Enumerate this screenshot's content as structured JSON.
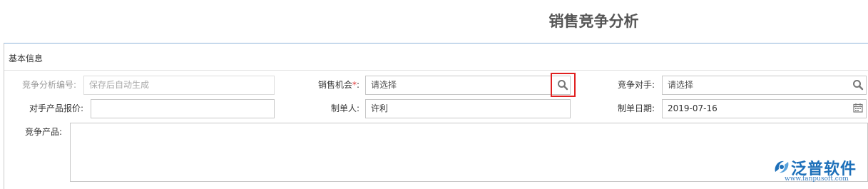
{
  "page": {
    "title": "销售竞争分析"
  },
  "section": {
    "title": "基本信息"
  },
  "fields": {
    "analysis_no": {
      "label": "竞争分析编号:",
      "placeholder": "保存后自动生成"
    },
    "sales_opportunity": {
      "label": "销售机会",
      "required_mark": "*",
      "colon": ":",
      "value": "请选择"
    },
    "competitor": {
      "label": "竞争对手:",
      "value": "请选择"
    },
    "competitor_price": {
      "label": "对手产品报价:",
      "value": ""
    },
    "creator": {
      "label": "制单人:",
      "value": "许利"
    },
    "create_date": {
      "label": "制单日期:",
      "value": "2019-07-16"
    },
    "competitor_product": {
      "label": "竞争产品:",
      "value": ""
    }
  },
  "icons": {
    "search": "search-icon",
    "calendar": "calendar-icon"
  },
  "colors": {
    "highlight": "#e02020",
    "logo": "#1c6fb9",
    "panel_border": "#8fb4d9"
  },
  "logo": {
    "name": "泛普软件",
    "url": "www.fanpusoft.com"
  }
}
